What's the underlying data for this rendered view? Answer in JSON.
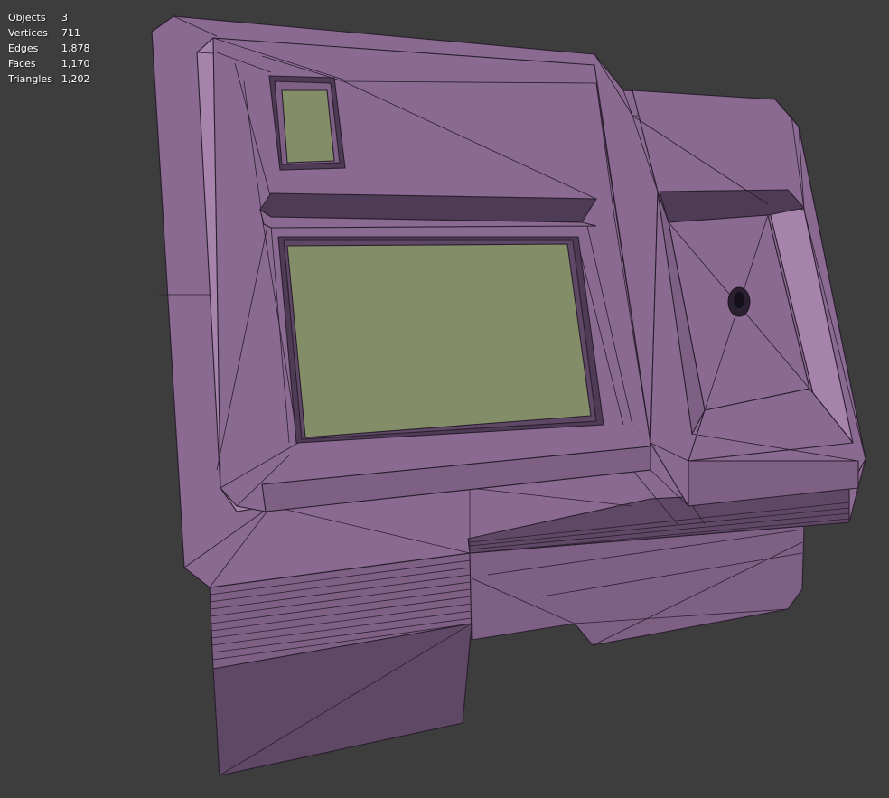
{
  "overlay": {
    "stats": [
      {
        "label": "Objects",
        "value": "3"
      },
      {
        "label": "Vertices",
        "value": "711"
      },
      {
        "label": "Edges",
        "value": "1,878"
      },
      {
        "label": "Faces",
        "value": "1,170"
      },
      {
        "label": "Triangles",
        "value": "1,202"
      }
    ]
  },
  "viewport": {
    "background": "#3d3d3d",
    "mesh_color": "#8b6a92",
    "screen_color": "#838e68",
    "edge_color": "#2a1f2e",
    "display_mode": "wireframe-overlay"
  }
}
